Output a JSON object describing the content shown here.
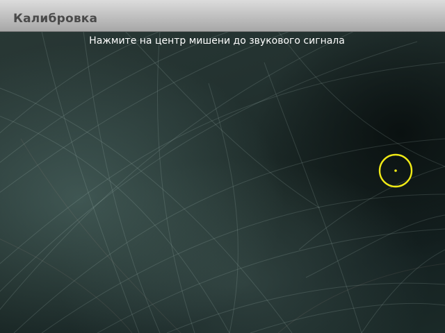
{
  "window": {
    "title": "Калибровка"
  },
  "instruction_text": "Нажмите на центр мишени до звукового сигнала",
  "target": {
    "icon": "calibration-target-icon",
    "color": "#f0ea16"
  },
  "colors": {
    "title_bar": "#c4c4c4",
    "title_text": "#4a4a4a",
    "instruction_text": "#ffffff",
    "background": "#1b2a28"
  }
}
